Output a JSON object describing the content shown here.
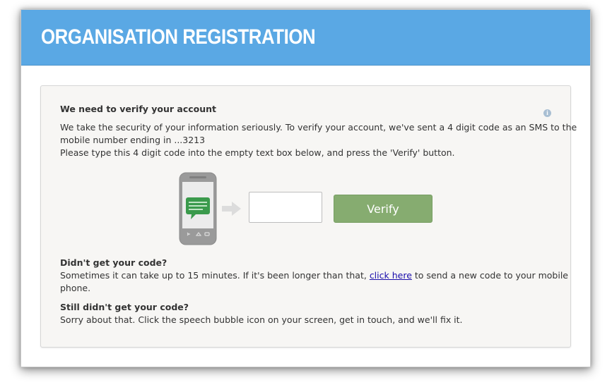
{
  "header": {
    "title": "ORGANISATION REGISTRATION"
  },
  "verify": {
    "heading": "We need to verify your account",
    "intro_line1": "We take the security of your information seriously. To verify your account, we've sent a 4 digit code as an SMS to the",
    "intro_line2": "mobile number ending in ...3213",
    "instruction": "Please type this 4 digit code into the empty text box below, and press the 'Verify' button.",
    "code_value": "",
    "button_label": "Verify",
    "info_icon": "info-icon"
  },
  "no_code": {
    "heading": "Didn't get your code?",
    "text_before_link": "Sometimes it can take up to 15 minutes. If it's been longer than that, ",
    "link_text": "click here",
    "text_after_link": " to send a new code to your mobile",
    "text_line2": "phone."
  },
  "still_no_code": {
    "heading": "Still didn't get your code?",
    "text": "Sorry about that. Click the speech bubble icon on your screen, get in touch, and we'll fix it."
  },
  "colors": {
    "header_bg": "#5aa8e4",
    "verify_button": "#86ac70",
    "link": "#1a0dab"
  }
}
